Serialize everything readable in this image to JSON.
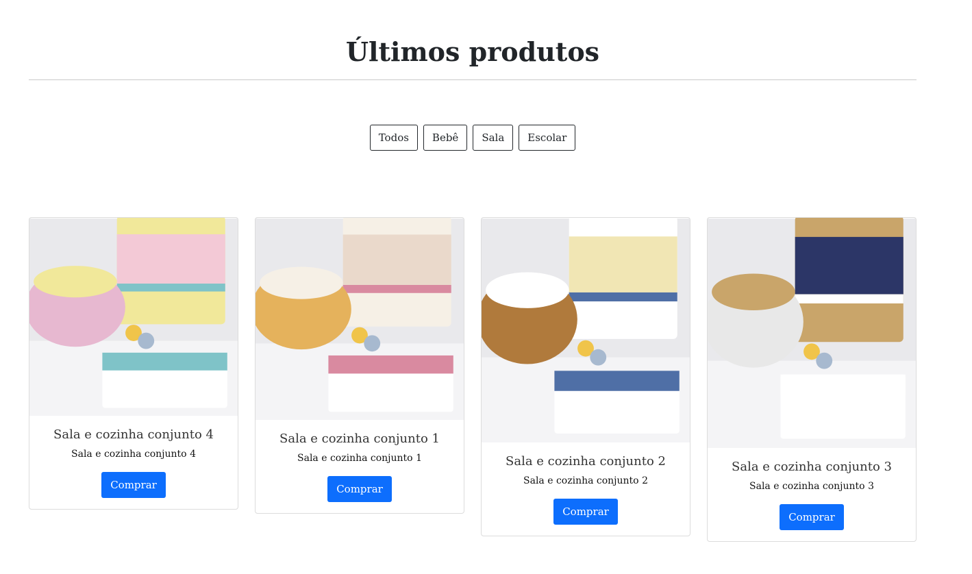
{
  "header": {
    "title": "Últimos produtos"
  },
  "filters": [
    "Todos",
    "Bebê",
    "Sala",
    "Escolar"
  ],
  "products": [
    {
      "title": "Sala e cozinha conjunto 4",
      "text": "Sala e cozinha conjunto 4",
      "button": "Comprar",
      "palette": [
        "#f3c9d6",
        "#7fc3c8",
        "#f1e89a",
        "#e7b8d0"
      ]
    },
    {
      "title": "Sala e cozinha conjunto 1",
      "text": "Sala e cozinha conjunto 1",
      "button": "Comprar",
      "palette": [
        "#ead9cb",
        "#d98aa0",
        "#f6f0e6",
        "#e5b25c"
      ]
    },
    {
      "title": "Sala e cozinha conjunto 2",
      "text": "Sala e cozinha conjunto 2",
      "button": "Comprar",
      "palette": [
        "#f1e6b4",
        "#4f6fa6",
        "#ffffff",
        "#b07a3c"
      ]
    },
    {
      "title": "Sala e cozinha conjunto 3",
      "text": "Sala e cozinha conjunto 3",
      "button": "Comprar",
      "palette": [
        "#2c3667",
        "#ffffff",
        "#c9a56a",
        "#e8e8e8"
      ]
    }
  ]
}
